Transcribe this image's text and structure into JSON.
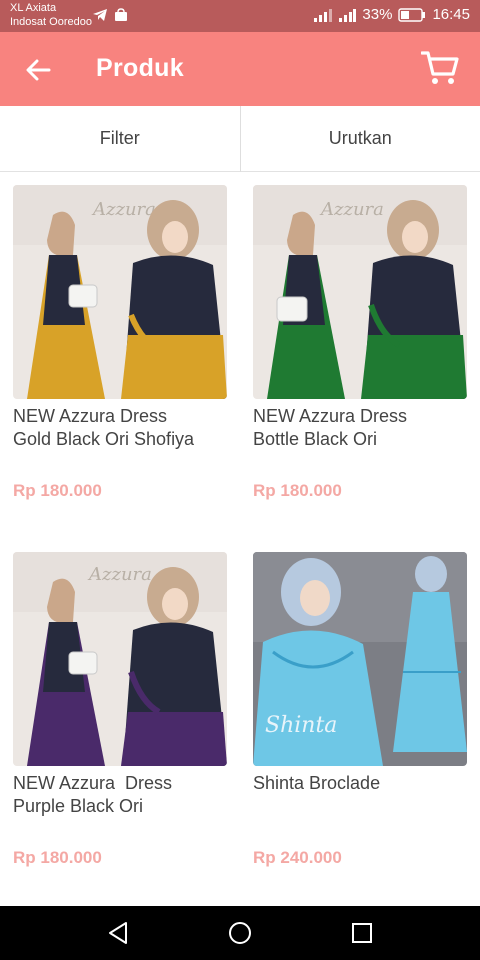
{
  "status_bar": {
    "carrier_1": "XL Axiata",
    "carrier_2": "Indosat Ooredoo",
    "battery": "33%",
    "time": "16:45"
  },
  "app_bar": {
    "title": "Produk",
    "back_icon": "arrow-left-icon",
    "cart_icon": "shopping-cart-icon"
  },
  "tabs": [
    {
      "label": "Filter"
    },
    {
      "label": "Urutkan"
    }
  ],
  "products": [
    {
      "name": "NEW Azzura Dress\nGold Black Ori Shofiya",
      "price": "Rp 180.000",
      "image": "azzura-gold-black-photo",
      "accent": "#d8a228"
    },
    {
      "name": "NEW Azzura Dress\nBottle Black Ori",
      "price": "Rp 180.000",
      "image": "azzura-bottle-black-photo",
      "accent": "#1f7a32"
    },
    {
      "name": "NEW Azzura  Dress\nPurple Black Ori",
      "price": "Rp 180.000",
      "image": "azzura-purple-black-photo",
      "accent": "#4a2a6a"
    },
    {
      "name": "Shinta Broclade",
      "price": "Rp 240.000",
      "image": "shinta-broclade-photo",
      "accent": "#6ec7e6"
    }
  ],
  "nav": {
    "back_icon": "triangle-back-icon",
    "home_icon": "circle-home-icon",
    "recents_icon": "square-recents-icon"
  },
  "colors": {
    "app_bar": "#f8837f",
    "status_bar": "#b85b5b",
    "price": "#f4a8a4",
    "text": "#444444"
  }
}
